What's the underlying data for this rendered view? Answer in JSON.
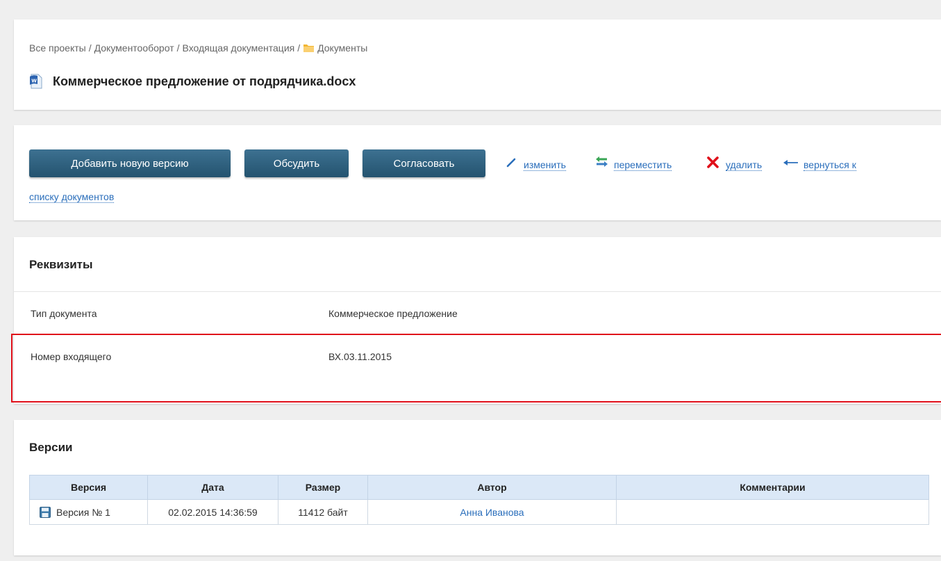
{
  "breadcrumb": {
    "items": [
      "Все проекты",
      "Документооборот",
      "Входящая документация"
    ],
    "current": "Документы",
    "separator": "/"
  },
  "document": {
    "title": "Коммерческое предложение от подрядчика.docx",
    "icon": "word-doc-icon"
  },
  "actions": {
    "add_version": "Добавить новую версию",
    "discuss": "Обсудить",
    "approve": "Согласовать",
    "edit": "изменить",
    "move": "переместить",
    "delete": "удалить",
    "back_line1": "вернуться к",
    "back_line2": "списку документов"
  },
  "requisites": {
    "title": "Реквизиты",
    "fields": [
      {
        "label": "Тип документа",
        "value": "Коммерческое предложение"
      },
      {
        "label": "Номер входящего",
        "value": "ВХ.03.11.2015"
      }
    ]
  },
  "versions": {
    "title": "Версии",
    "columns": [
      "Версия",
      "Дата",
      "Размер",
      "Автор",
      "Комментарии"
    ],
    "rows": [
      {
        "version": "Версия № 1",
        "date": "02.02.2015 14:36:59",
        "size": "11412 байт",
        "author": "Анна Иванова",
        "comment": ""
      }
    ]
  },
  "colors": {
    "accent_button": "#2d5f7d",
    "link": "#2a6ebb",
    "highlight_border": "#e0101a",
    "table_header": "#dbe8f7"
  }
}
